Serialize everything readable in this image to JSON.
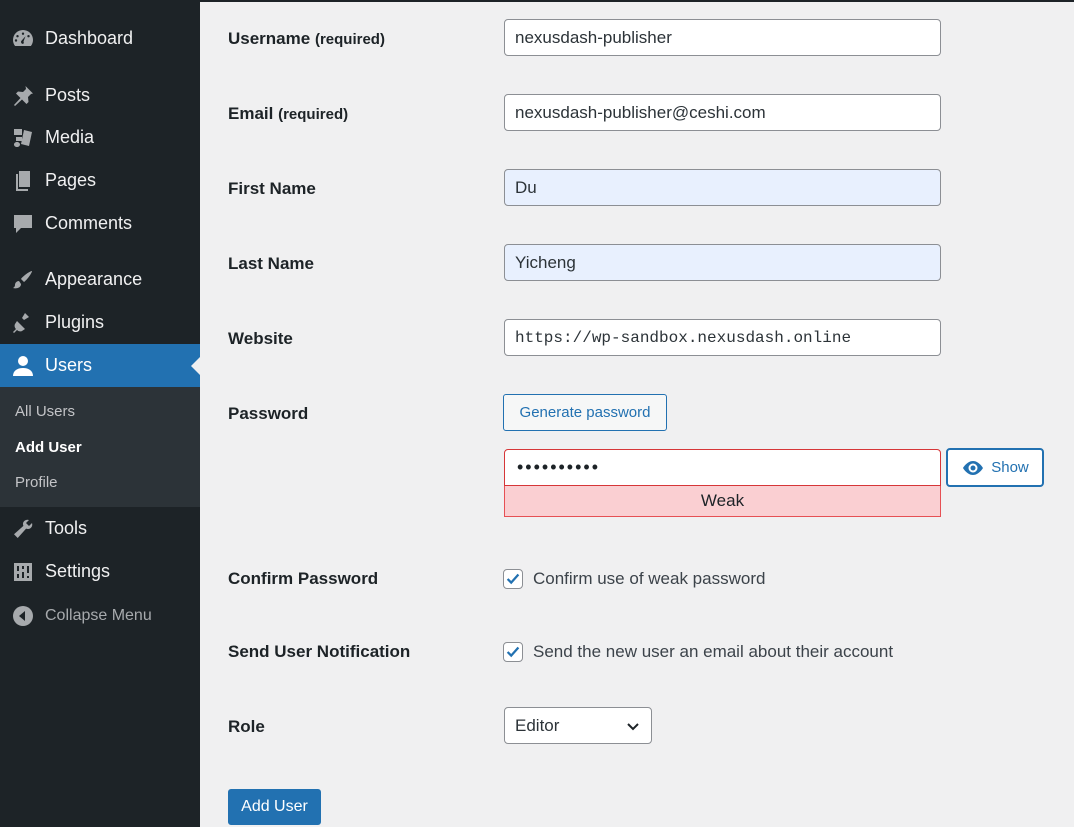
{
  "sidebar": {
    "items": [
      {
        "label": "Dashboard",
        "icon": "dashboard-icon"
      },
      {
        "label": "Posts",
        "icon": "pushpin-icon"
      },
      {
        "label": "Media",
        "icon": "media-icon"
      },
      {
        "label": "Pages",
        "icon": "pages-icon"
      },
      {
        "label": "Comments",
        "icon": "comment-icon"
      },
      {
        "label": "Appearance",
        "icon": "paintbrush-icon"
      },
      {
        "label": "Plugins",
        "icon": "plugin-icon"
      },
      {
        "label": "Users",
        "icon": "user-icon"
      },
      {
        "label": "Tools",
        "icon": "wrench-icon"
      },
      {
        "label": "Settings",
        "icon": "settings-icon"
      },
      {
        "label": "Collapse Menu",
        "icon": "collapse-icon"
      }
    ],
    "submenu": [
      "All Users",
      "Add User",
      "Profile"
    ]
  },
  "form": {
    "username_label": "Username",
    "username_req": "(required)",
    "username_value": "nexusdash-publisher",
    "email_label": "Email",
    "email_req": "(required)",
    "email_value": "nexusdash-publisher@ceshi.com",
    "first_name_label": "First Name",
    "first_name_value": "Du",
    "last_name_label": "Last Name",
    "last_name_value": "Yicheng",
    "website_label": "Website",
    "website_value": "https://wp-sandbox.nexusdash.online",
    "password_label": "Password",
    "generate_password_label": "Generate password",
    "password_mask": "••••••••••",
    "show_label": "Show",
    "strength_label": "Weak",
    "confirm_password_label": "Confirm Password",
    "confirm_weak_label": "Confirm use of weak password",
    "send_notification_label": "Send User Notification",
    "send_notification_text": "Send the new user an email about their account",
    "role_label": "Role",
    "role_value": "Editor",
    "submit_label": "Add User"
  },
  "colors": {
    "sidebar_bg": "#1d2327",
    "accent": "#2271b1",
    "weak_bg": "#facfd2",
    "weak_border": "#d63638"
  }
}
